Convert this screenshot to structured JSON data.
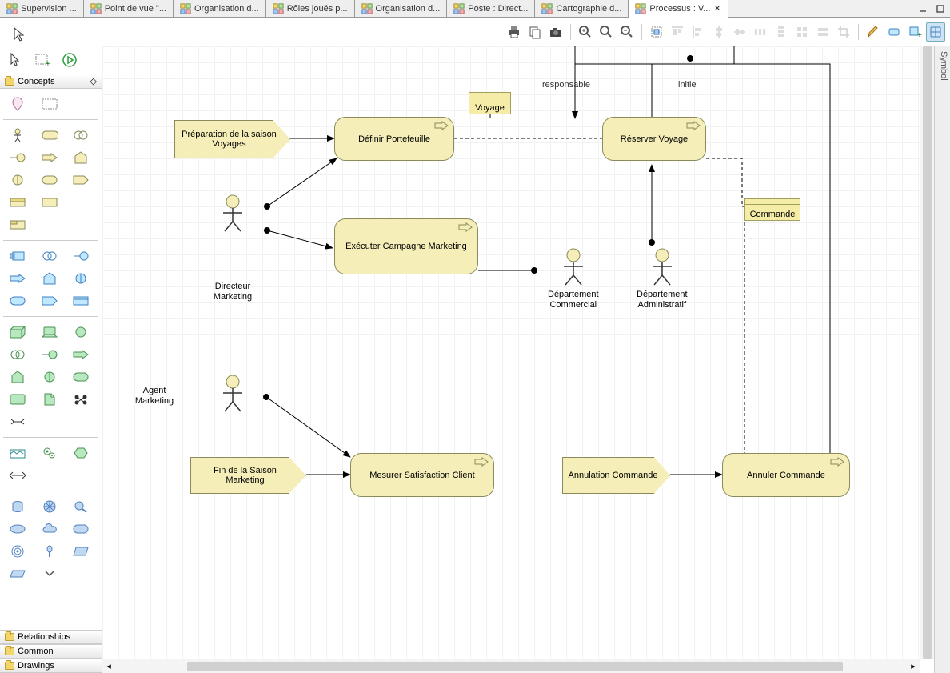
{
  "tabs": [
    {
      "label": "Supervision ...",
      "icon": "diagram-icon",
      "active": false
    },
    {
      "label": "Point de vue \"...",
      "icon": "diagram-icon",
      "active": false
    },
    {
      "label": "Organisation d...",
      "icon": "diagram-icon",
      "active": false
    },
    {
      "label": "Rôles joués p...",
      "icon": "diagram-icon",
      "active": false
    },
    {
      "label": "Organisation d...",
      "icon": "diagram-icon",
      "active": false
    },
    {
      "label": "Poste : Direct...",
      "icon": "diagram-icon",
      "active": false
    },
    {
      "label": "Cartographie d...",
      "icon": "diagram-icon",
      "active": false
    },
    {
      "label": "Processus : V...",
      "icon": "diagram-icon",
      "active": true
    }
  ],
  "palette": {
    "sections": {
      "concepts": "Concepts",
      "relationships": "Relationships",
      "common": "Common",
      "drawings": "Drawings"
    }
  },
  "side_panel": {
    "label": "Symbol"
  },
  "edge_labels": {
    "responsable": "responsable",
    "initie": "initie"
  },
  "diagram": {
    "events": {
      "prep_saison": "Préparation de la saison Voyages",
      "fin_saison": "Fin de la Saison Marketing",
      "annulation": "Annulation Commande"
    },
    "processes": {
      "definir": "Définir Portefeuille",
      "executer": "Exécuter Campagne Marketing",
      "reserver": "Réserver Voyage",
      "mesurer": "Mesurer Satisfaction Client",
      "annuler": "Annuler Commande"
    },
    "data": {
      "voyage": "Voyage",
      "commande": "Commande"
    },
    "actors": {
      "directeur": "Directeur\nMarketing",
      "agent": "Agent\nMarketing",
      "dept_commercial": "Département\nCommercial",
      "dept_admin": "Département\nAdministratif"
    }
  }
}
